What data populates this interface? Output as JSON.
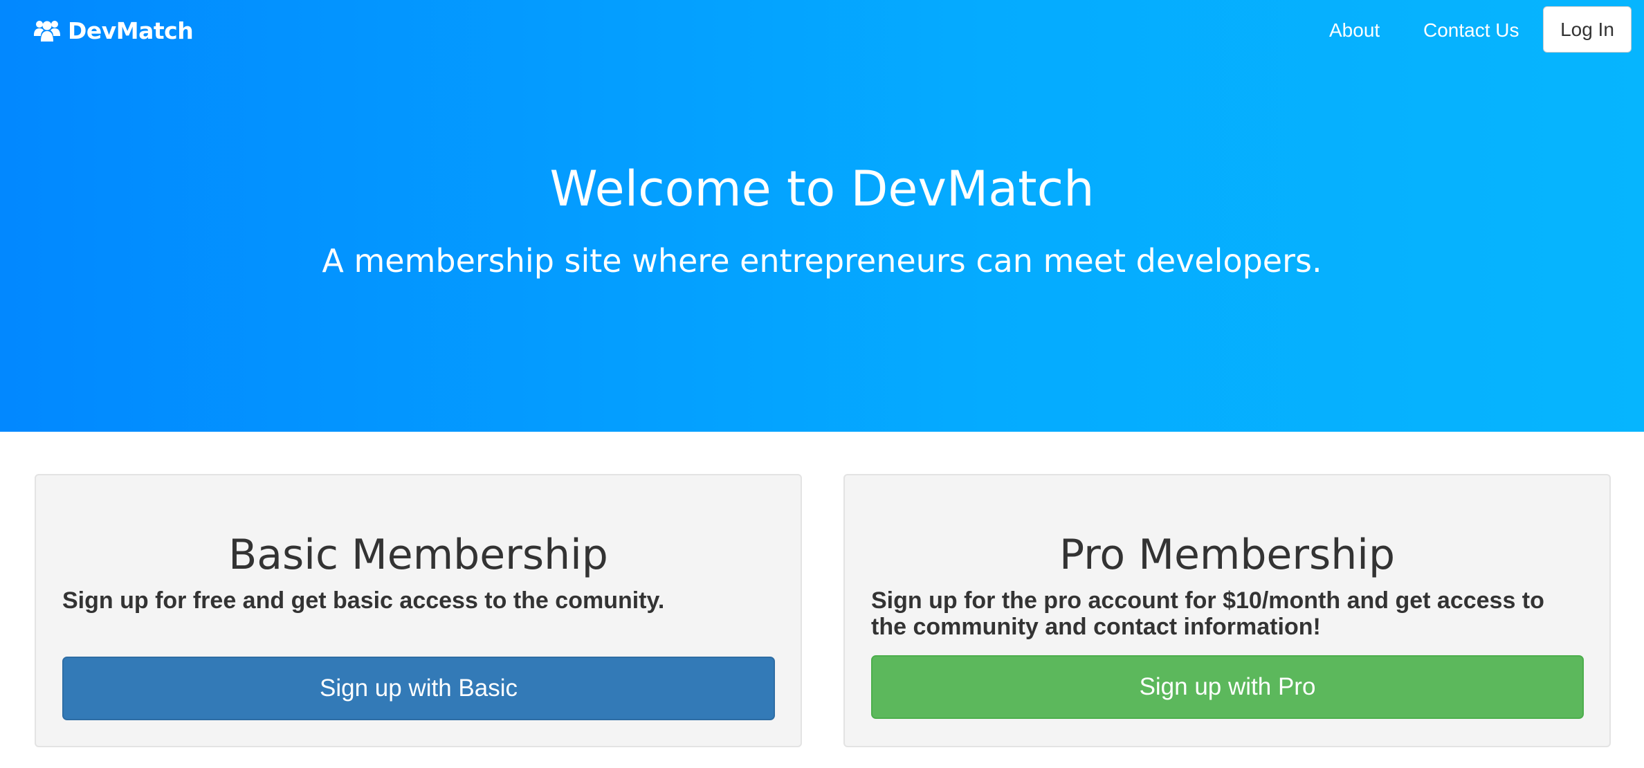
{
  "navbar": {
    "brand_icon": "users-icon",
    "brand_name": "DevMatch",
    "links": [
      {
        "label": "About"
      },
      {
        "label": "Contact Us"
      }
    ],
    "login_label": "Log In"
  },
  "hero": {
    "title": "Welcome to DevMatch",
    "subtitle": "A membership site where entrepreneurs can meet developers.",
    "gradient_start": "#0288ff",
    "gradient_end": "#06b5fe"
  },
  "plans": {
    "basic": {
      "title": "Basic Membership",
      "description": "Sign up for free and get basic access to the comunity.",
      "button_label": "Sign up with Basic",
      "button_color": "#337ab7"
    },
    "pro": {
      "title": "Pro Membership",
      "description": "Sign up for the pro account for $10/month and get access to the community and contact information!",
      "button_label": "Sign up with Pro",
      "button_color": "#5cb85c"
    }
  }
}
